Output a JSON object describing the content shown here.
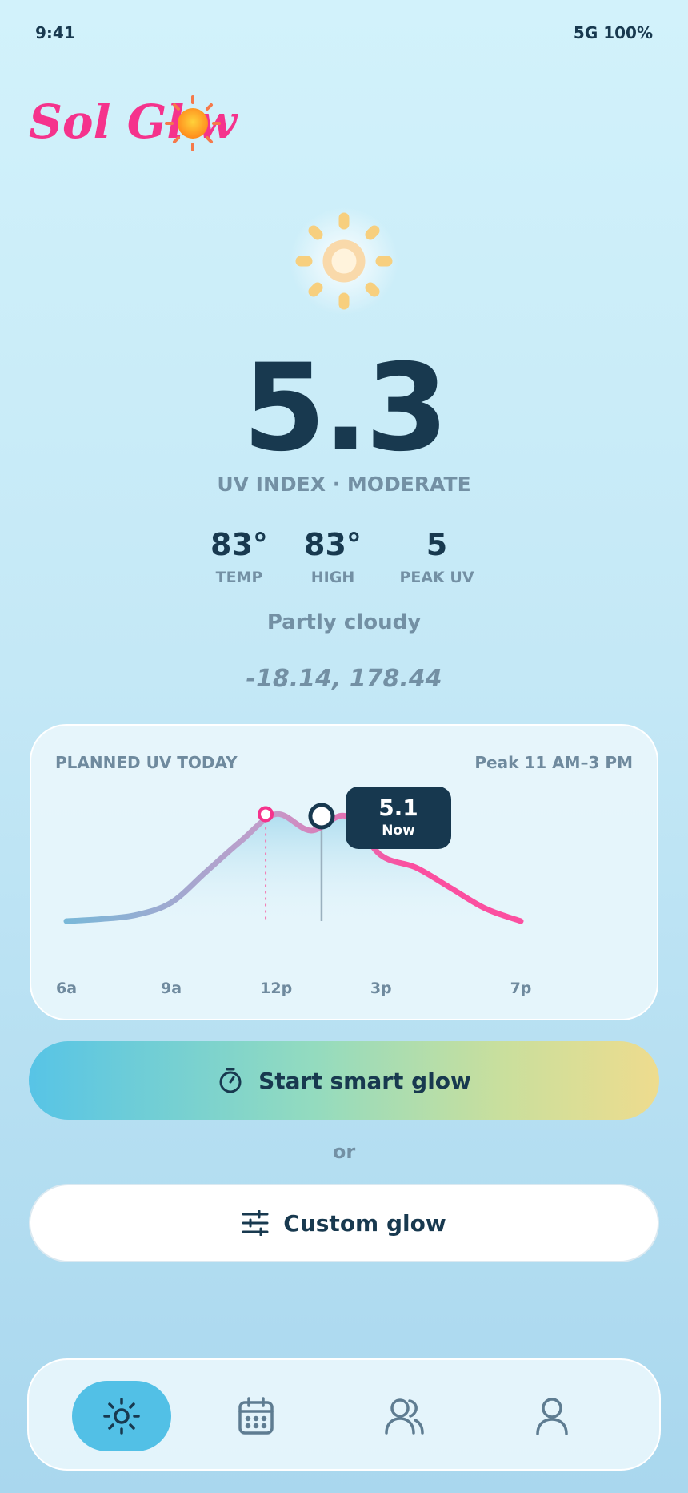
{
  "status": {
    "time": "9:41",
    "signal": "5G 100%"
  },
  "app": {
    "name": "Sol Glow"
  },
  "uv": {
    "value": "5.3",
    "label": "UV INDEX · MODERATE"
  },
  "stats": [
    {
      "value": "83°",
      "label": "TEMP"
    },
    {
      "value": "83°",
      "label": "HIGH"
    },
    {
      "value": "5",
      "label": "PEAK UV"
    }
  ],
  "weather": {
    "condition": "Partly cloudy",
    "coordinates": "-18.14, 178.44"
  },
  "chart_card": {
    "title": "PLANNED UV TODAY",
    "peak": "Peak 11 AM–3 PM",
    "tooltip_value": "5.1",
    "tooltip_label": "Now"
  },
  "chart_data": {
    "type": "line",
    "x_ticks": [
      "6a",
      "9a",
      "12p",
      "3p",
      "7p"
    ],
    "x": [
      6,
      7,
      8,
      9,
      10,
      11,
      12,
      13,
      14,
      15,
      16,
      17,
      18,
      19
    ],
    "values": [
      0.0,
      0.1,
      0.3,
      0.9,
      2.4,
      3.9,
      5.2,
      4.4,
      5.1,
      3.2,
      2.6,
      1.6,
      0.6,
      0.0
    ],
    "marker_peak": {
      "x": 11.7,
      "y": 5.2
    },
    "marker_now": {
      "x": 13.3,
      "y": 5.1
    },
    "ylim": [
      0,
      6
    ],
    "colors": {
      "start": "#79b8d8",
      "mid": "#c49bc9",
      "end": "#fb4fa0"
    }
  },
  "actions": {
    "primary_label": "Start smart glow",
    "or_label": "or",
    "secondary_label": "Custom glow"
  },
  "tabs": [
    {
      "icon": "sun-icon",
      "active": true
    },
    {
      "icon": "calendar-icon",
      "active": false
    },
    {
      "icon": "users-icon",
      "active": false
    },
    {
      "icon": "profile-icon",
      "active": false
    }
  ],
  "colors": {
    "accent": "#52c0e6",
    "brand": "#f5338c",
    "ink": "#18394f",
    "muted": "#7390a4"
  }
}
